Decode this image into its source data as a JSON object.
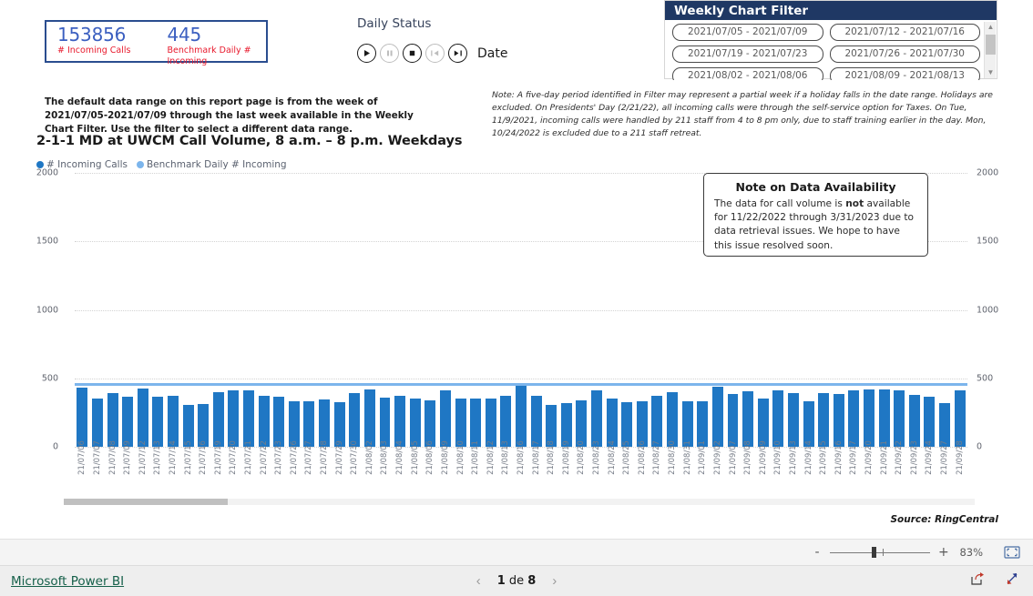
{
  "kpi": {
    "cards": [
      {
        "value": "153856",
        "label": "# Incoming Calls"
      },
      {
        "value": "445",
        "label": "Benchmark Daily # Incoming"
      }
    ],
    "border_color": "#2a4d8f",
    "value_color": "#3b5fc0",
    "label_color": "#e8192c"
  },
  "daily_status": {
    "title": "Daily Status",
    "date_label": "Date",
    "controls": [
      {
        "name": "play",
        "state": "enabled"
      },
      {
        "name": "pause",
        "state": "disabled"
      },
      {
        "name": "stop",
        "state": "enabled"
      },
      {
        "name": "previous",
        "state": "disabled"
      },
      {
        "name": "next",
        "state": "enabled"
      }
    ]
  },
  "weekly_filter": {
    "title": "Weekly Chart Filter",
    "header_color": "#1f3864",
    "options": [
      "2021/07/05 - 2021/07/09",
      "2021/07/12 - 2021/07/16",
      "2021/07/19 - 2021/07/23",
      "2021/07/26 - 2021/07/30",
      "2021/08/02 - 2021/08/06",
      "2021/08/09 - 2021/08/13"
    ]
  },
  "notes": {
    "default_range": "The default data range on this report page is from the week of 2021/07/05-2021/07/09 through the last week available in the Weekly Chart Filter. Use the filter to select a different data range.",
    "holiday": "Note: A five-day period identified in Filter may represent a partial week if a holiday falls in the date range. Holidays are excluded. On Presidents' Day (2/21/22), all incoming calls were through the self-service option for Taxes. On Tue, 11/9/2021, incoming calls were handled by 211 staff from 4 to 8 pm only, due to staff training earlier in the day. Mon, 10/24/2022 is excluded due to a 211 staff retreat."
  },
  "data_availability": {
    "title": "Note on Data Availability",
    "text_part1": "The data for call volume is ",
    "text_bold": "not",
    "text_part2": " available for 11/22/2022 through 3/31/2023 due to data retrieval issues. We hope to have this issue resolved soon."
  },
  "source_label": "Source: RingCentral",
  "zoom_bar": {
    "minus": "-",
    "plus": "+",
    "percent": "83%"
  },
  "footer": {
    "brand": "Microsoft Power BI",
    "page_prefix": "1",
    "page_middle": " de ",
    "page_total": "8"
  },
  "chart_data": {
    "type": "bar",
    "title": "2-1-1 MD at UWCM Call Volume, 8 a.m. – 8 p.m. Weekdays",
    "xlabel": "",
    "ylabel": "",
    "ylim": [
      0,
      2000
    ],
    "yticks": [
      0,
      500,
      1000,
      1500,
      2000
    ],
    "grid": true,
    "legend_position": "top-left",
    "legend": [
      {
        "name": "# Incoming Calls",
        "color": "#1f77c4",
        "type": "bar"
      },
      {
        "name": "Benchmark Daily # Incoming",
        "color": "#7cb5ec",
        "type": "line"
      }
    ],
    "benchmark_value": 445,
    "categories": [
      "21/07/06",
      "21/07/07",
      "21/07/08",
      "21/07/09",
      "21/07/12",
      "21/07/13",
      "21/07/14",
      "21/07/15",
      "21/07/16",
      "21/07/19",
      "21/07/20",
      "21/07/21",
      "21/07/22",
      "21/07/23",
      "21/07/26",
      "21/07/27",
      "21/07/28",
      "21/07/29",
      "21/07/30",
      "21/08/02",
      "21/08/03",
      "21/08/04",
      "21/08/05",
      "21/08/06",
      "21/08/09",
      "21/08/10",
      "21/08/11",
      "21/08/12",
      "21/08/13",
      "21/08/16",
      "21/08/17",
      "21/08/18",
      "21/08/19",
      "21/08/20",
      "21/08/23",
      "21/08/24",
      "21/08/25",
      "21/08/26",
      "21/08/27",
      "21/08/30",
      "21/08/31",
      "21/09/01",
      "21/09/02",
      "21/09/07",
      "21/09/08",
      "21/09/09",
      "21/09/10",
      "21/09/13",
      "21/09/14",
      "21/09/15",
      "21/09/16",
      "21/09/17",
      "21/09/20",
      "21/09/21",
      "21/09/22",
      "21/09/23",
      "21/09/24",
      "21/09/27",
      "21/09/28"
    ],
    "series": [
      {
        "name": "# Incoming Calls",
        "color": "#1f77c4",
        "values": [
          430,
          355,
          390,
          365,
          425,
          365,
          370,
          305,
          315,
          400,
          410,
          410,
          375,
          365,
          335,
          330,
          345,
          325,
          390,
          420,
          360,
          375,
          355,
          340,
          415,
          355,
          350,
          355,
          375,
          445,
          375,
          305,
          320,
          340,
          415,
          355,
          325,
          335,
          375,
          400,
          330,
          335,
          440,
          385,
          405,
          355,
          410,
          390,
          330,
          395,
          385,
          415,
          420,
          420,
          410,
          380,
          365,
          320,
          415
        ]
      },
      {
        "name": "Benchmark Daily # Incoming",
        "color": "#7cb5ec",
        "constant": 445
      }
    ]
  }
}
